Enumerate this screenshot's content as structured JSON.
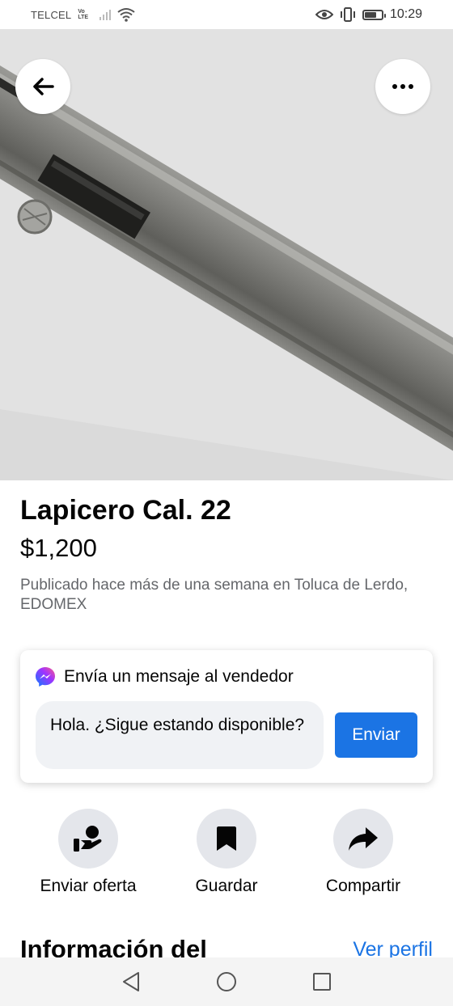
{
  "status_bar": {
    "carrier": "TELCEL",
    "volte_top": "Vo",
    "volte_bottom": "LTE",
    "time": "10:29",
    "battery_level": 0.7
  },
  "hero": {
    "back_icon": "arrow-left-icon",
    "more_icon": "more-horizontal-icon"
  },
  "product": {
    "title": "Lapicero Cal. 22",
    "price": "$1,200",
    "meta": "Publicado hace más de una semana en Toluca de Lerdo, EDOMEX"
  },
  "message_card": {
    "header": "Envía un mensaje al vendedor",
    "header_icon": "messenger-icon",
    "input_value": "Hola. ¿Sigue estando disponible?",
    "send_label": "Enviar"
  },
  "actions": [
    {
      "label": "Enviar oferta",
      "icon": "offer-hand-icon"
    },
    {
      "label": "Guardar",
      "icon": "bookmark-icon"
    },
    {
      "label": "Compartir",
      "icon": "share-arrow-icon"
    }
  ],
  "seller_section": {
    "title": "Información del",
    "link": "Ver perfil"
  },
  "colors": {
    "accent": "#1b74e4",
    "muted_text": "#65676b",
    "input_bg": "#f0f2f5",
    "action_bg": "#e4e6eb"
  }
}
